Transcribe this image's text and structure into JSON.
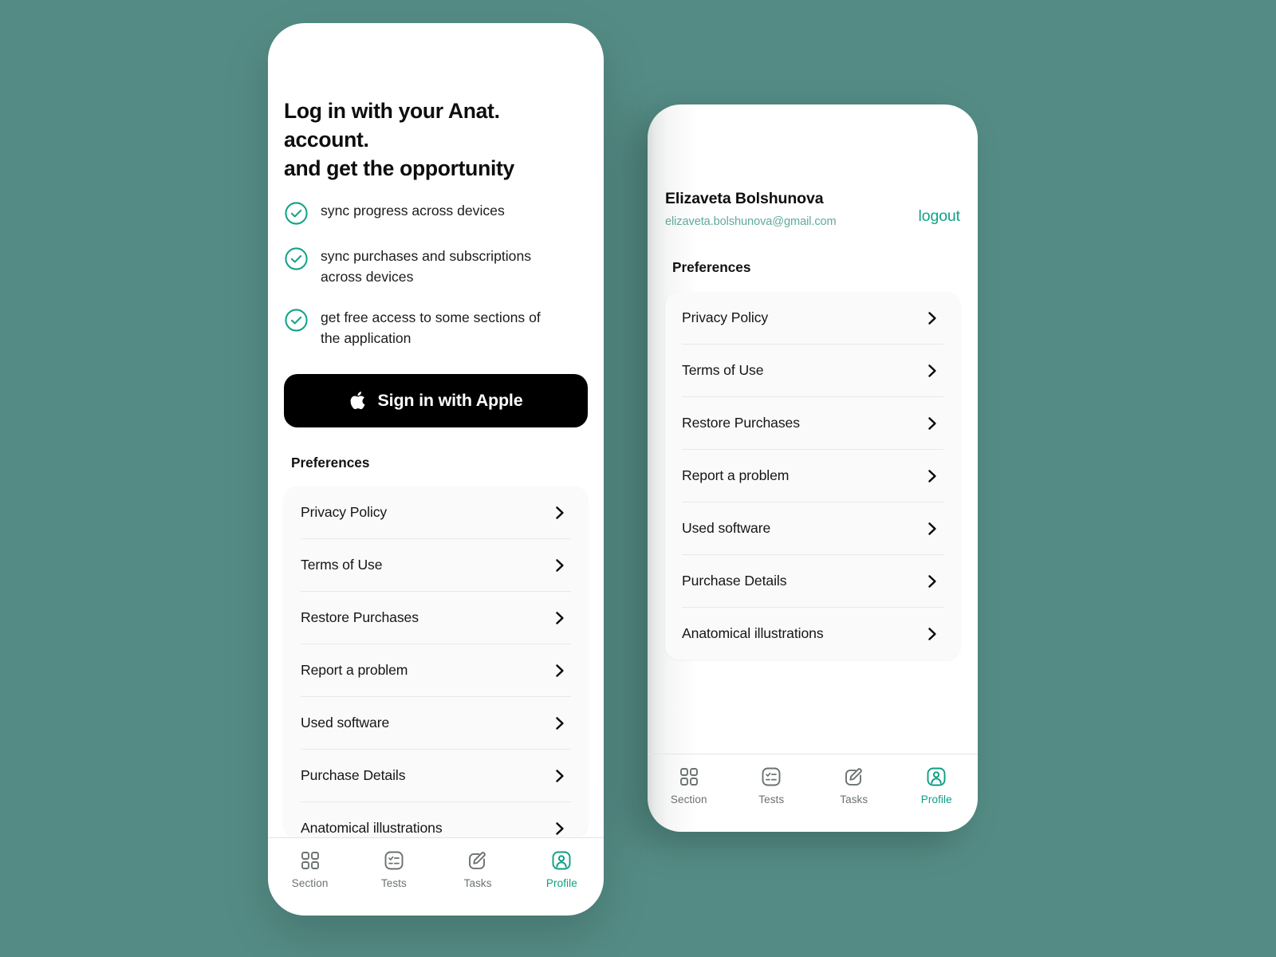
{
  "theme": {
    "background": "#548C85",
    "accent": "#12A287",
    "accent_light": "#5FA99C",
    "text": "#141616",
    "apple_button_bg": "#000000"
  },
  "login_screen": {
    "headline_line1": "Log in with your Anat. account.",
    "headline_line2": "and get the opportunity",
    "benefits": [
      {
        "icon": "check-circle-icon",
        "text": "sync progress across devices"
      },
      {
        "icon": "check-circle-icon",
        "text": "sync purchases and subscriptions across devices"
      },
      {
        "icon": "check-circle-icon",
        "text": "get free access to some sections of the application"
      }
    ],
    "apple_button": {
      "icon": "apple-logo-icon",
      "label": "Sign in with Apple"
    },
    "preferences_title": "Preferences"
  },
  "profile_screen": {
    "account": {
      "name": "Elizaveta Bolshunova",
      "email": "elizaveta.bolshunova@gmail.com",
      "logout_label": "logout"
    },
    "preferences_title": "Preferences"
  },
  "preferences_menu": [
    {
      "label": "Privacy Policy",
      "icon": "chevron-right-icon"
    },
    {
      "label": "Terms of Use",
      "icon": "chevron-right-icon"
    },
    {
      "label": "Restore Purchases",
      "icon": "chevron-right-icon"
    },
    {
      "label": "Report a problem",
      "icon": "chevron-right-icon"
    },
    {
      "label": "Used software",
      "icon": "chevron-right-icon"
    },
    {
      "label": "Purchase Details",
      "icon": "chevron-right-icon"
    },
    {
      "label": "Anatomical illustrations",
      "icon": "chevron-right-icon"
    }
  ],
  "tabbar": {
    "tabs": [
      {
        "label": "Section",
        "icon": "grid-squares-icon",
        "active": false
      },
      {
        "label": "Tests",
        "icon": "checklist-icon",
        "active": false
      },
      {
        "label": "Tasks",
        "icon": "pencil-edit-icon",
        "active": false
      },
      {
        "label": "Profile",
        "icon": "person-icon",
        "active": true
      }
    ]
  }
}
